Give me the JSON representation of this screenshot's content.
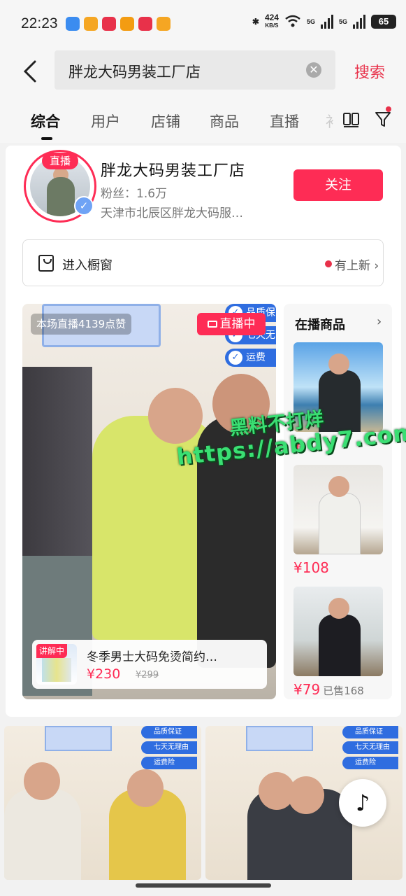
{
  "status_bar": {
    "time": "22:23",
    "net_speed": "424",
    "net_unit": "KB/S",
    "signal1": "5G",
    "signal2": "5G",
    "battery": "65"
  },
  "header": {
    "query": "胖龙大码男装工厂店",
    "search_label": "搜索"
  },
  "tabs": [
    {
      "label": "综合",
      "active": true
    },
    {
      "label": "用户"
    },
    {
      "label": "店铺"
    },
    {
      "label": "商品"
    },
    {
      "label": "直播"
    },
    {
      "label": "补"
    }
  ],
  "shop": {
    "live_tag": "直播",
    "name": "胖龙大码男装工厂店",
    "fans": "粉丝：1.6万",
    "address": "天津市北辰区胖龙大码服…",
    "follow_label": "关注",
    "window_label": "进入橱窗",
    "new_label": "有上新"
  },
  "live": {
    "viewers": "本场直播4139点赞",
    "badge": "直播中",
    "promises": [
      "品质保",
      "七天无",
      "运费"
    ],
    "explaining_tag": "讲解中",
    "item_title": "冬季男士大码免烫简约…",
    "price": "¥230",
    "original_price": "¥299"
  },
  "side_products": {
    "heading": "在播商品",
    "items": [
      {
        "price": "¥"
      },
      {
        "price": "¥108"
      },
      {
        "price": "¥79",
        "sold": "已售168"
      }
    ]
  },
  "feed": {
    "promises": [
      "品质保证",
      "七天无理由",
      "运费险"
    ]
  },
  "watermark": {
    "line1": "黑料不打烊",
    "line2": "https://abdy7.com"
  },
  "colors": {
    "accent": "#fe2c55",
    "search_red": "#e8314a",
    "promise_blue": "#2f6de0",
    "watermark_green": "#3adf73"
  }
}
